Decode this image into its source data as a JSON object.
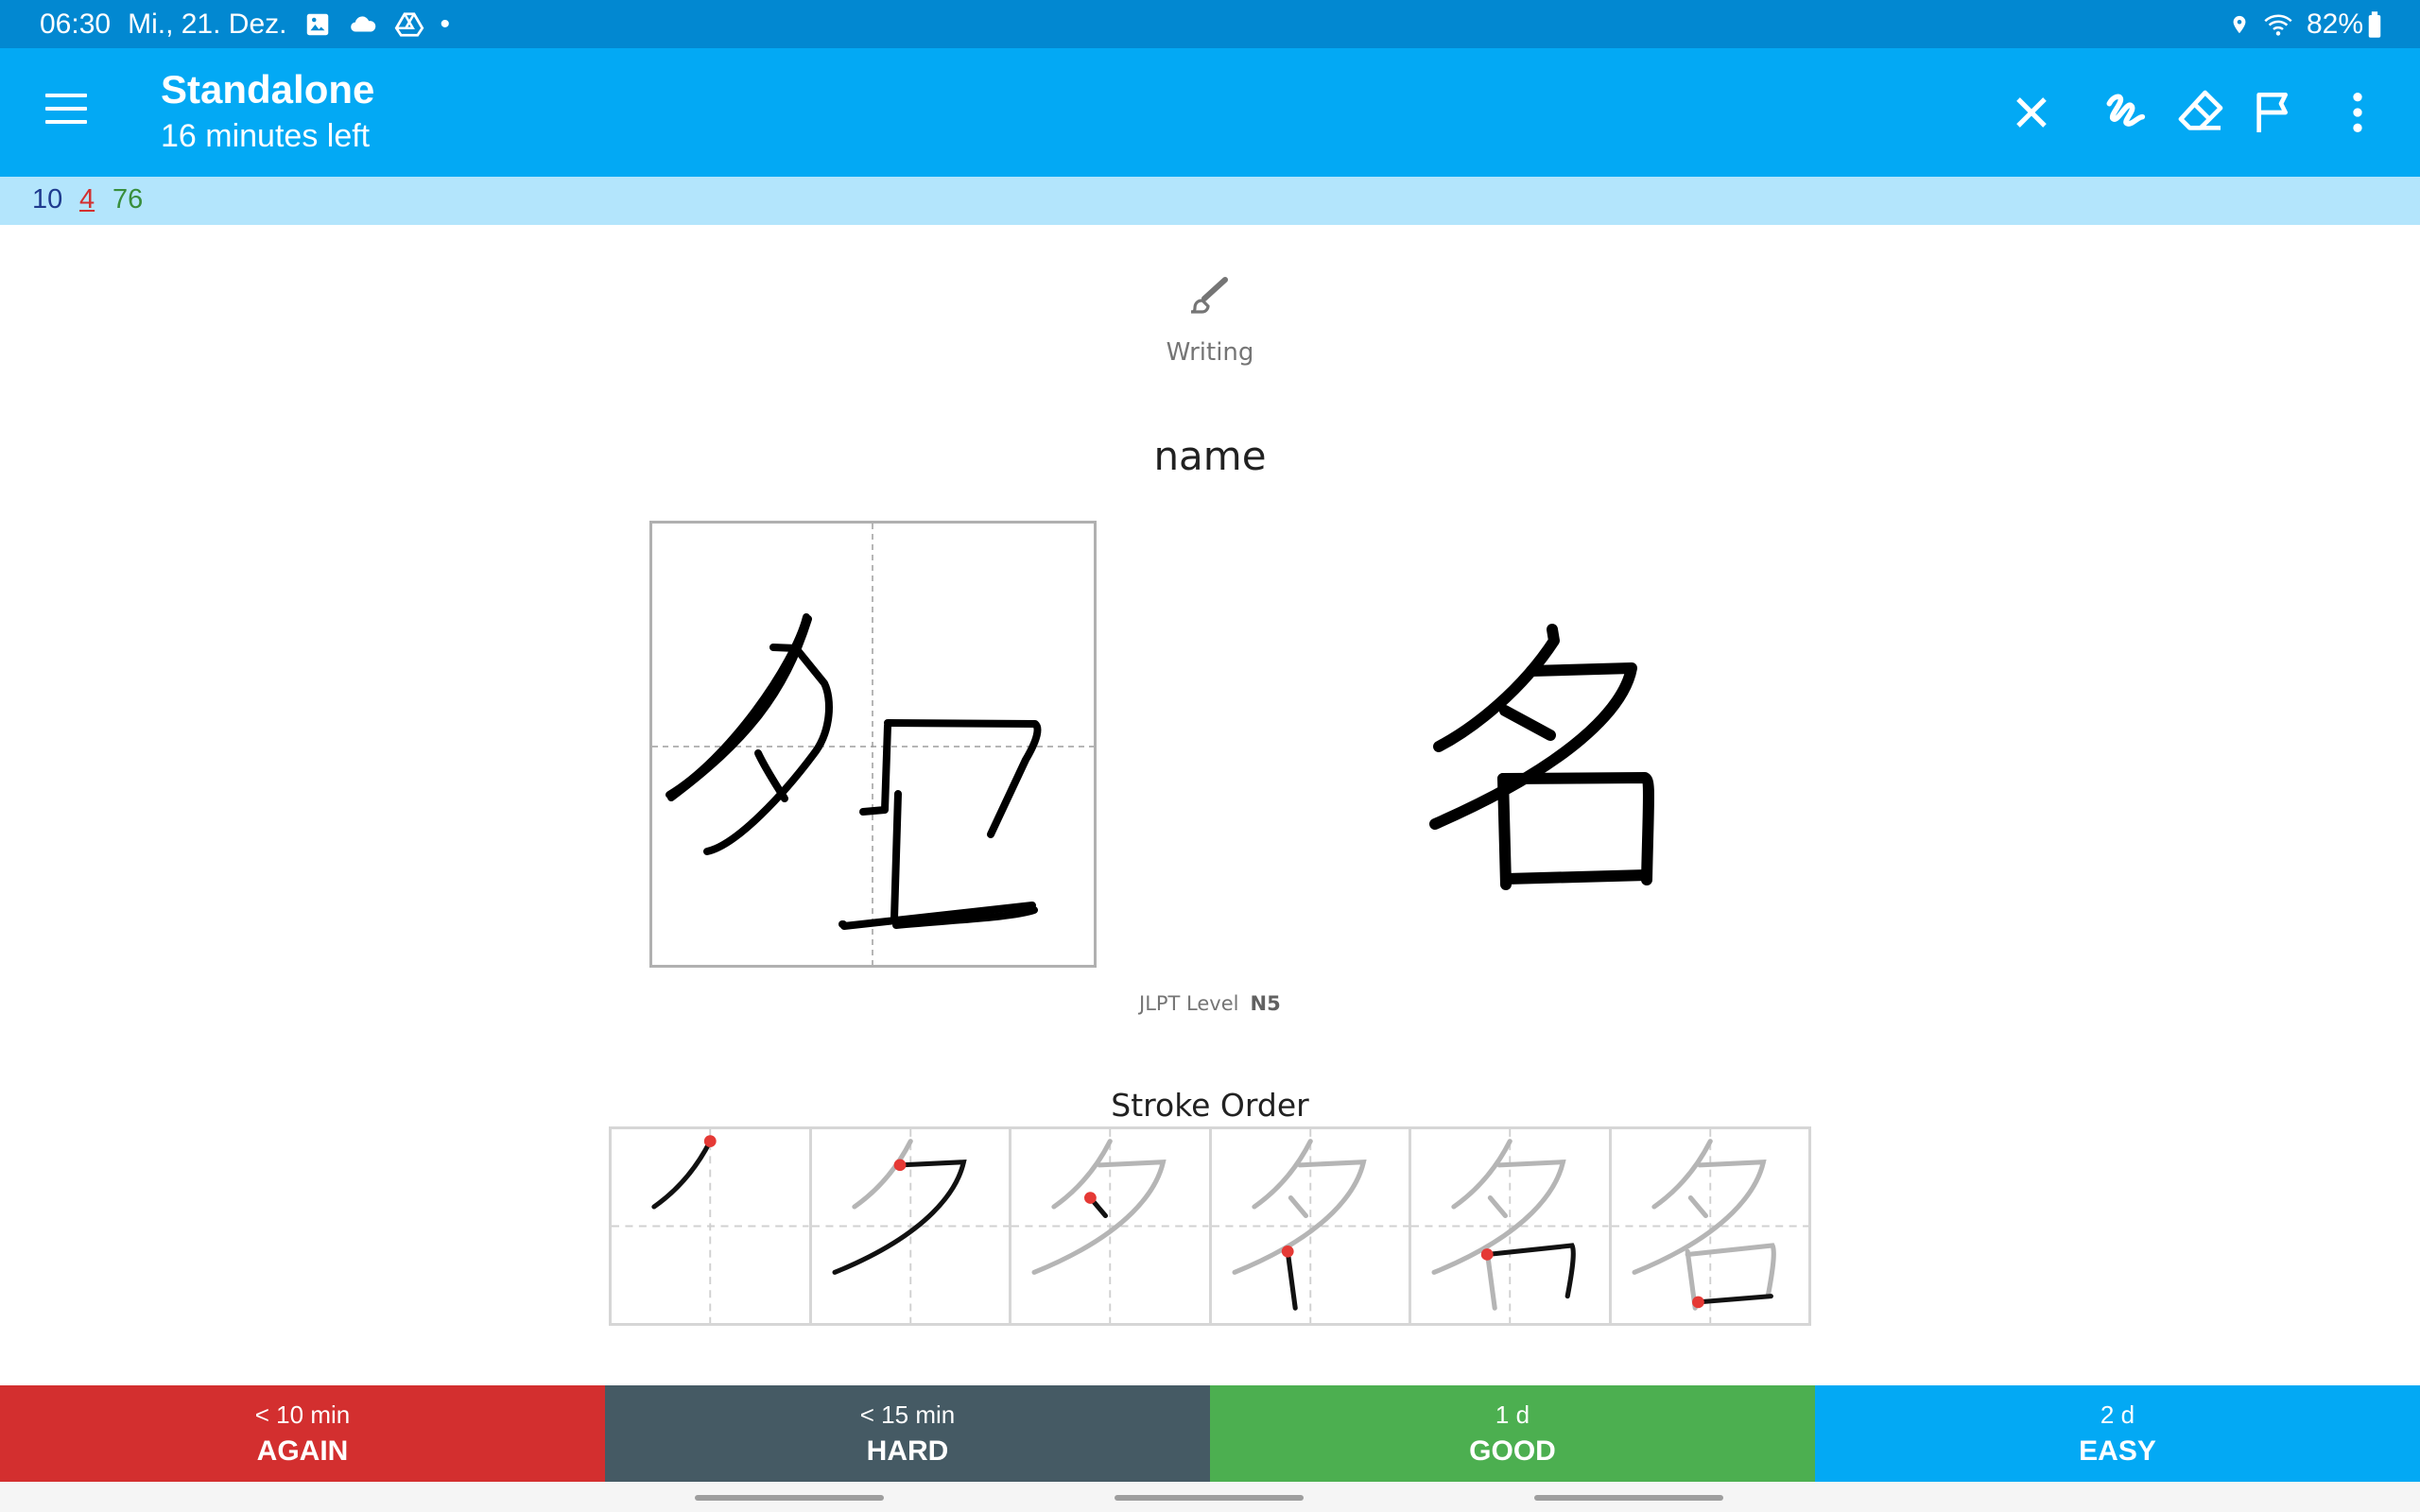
{
  "status_bar": {
    "time": "06:30",
    "date": "Mi., 21. Dez.",
    "notification_icons": [
      "image-icon",
      "cloud-icon",
      "drive-icon"
    ],
    "dot": "•",
    "battery": "82%",
    "right_icons": [
      "location-icon",
      "wifi-icon",
      "battery-icon"
    ]
  },
  "app_bar": {
    "title": "Standalone",
    "subtitle": "16 minutes left",
    "actions": [
      "close-icon",
      "whiteboard-icon",
      "eraser-icon",
      "flag-icon",
      "more-options-icon"
    ]
  },
  "counts": {
    "new": "10",
    "learning": "4",
    "review": "76"
  },
  "card": {
    "type_icon": "brush-icon",
    "type_label": "Writing",
    "prompt": "name",
    "answer_kanji": "名",
    "jlpt_label": "JLPT Level",
    "jlpt_value": "N5",
    "stroke_order_title": "Stroke Order",
    "stroke_count": 6
  },
  "answer_buttons": [
    {
      "label": "AGAIN",
      "interval": "< 10 min",
      "color": "#d32f2f"
    },
    {
      "label": "HARD",
      "interval": "< 15 min",
      "color": "#455a64"
    },
    {
      "label": "GOOD",
      "interval": "1 d",
      "color": "#4caf50"
    },
    {
      "label": "EASY",
      "interval": "2 d",
      "color": "#03a9f4"
    }
  ],
  "colors": {
    "status_bar": "#0288d1",
    "app_bar": "#03a9f4",
    "counts_bar": "#b3e5fc",
    "stroke_start_dot": "#e53935"
  }
}
